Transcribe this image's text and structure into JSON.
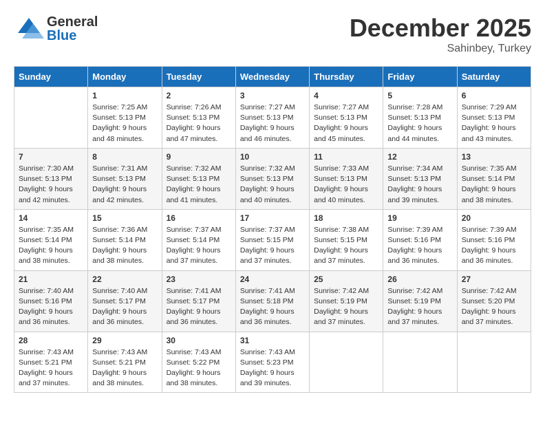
{
  "header": {
    "logo_general": "General",
    "logo_blue": "Blue",
    "month": "December 2025",
    "location": "Sahinbey, Turkey"
  },
  "days_of_week": [
    "Sunday",
    "Monday",
    "Tuesday",
    "Wednesday",
    "Thursday",
    "Friday",
    "Saturday"
  ],
  "weeks": [
    [
      {
        "day": "",
        "info": ""
      },
      {
        "day": "1",
        "info": "Sunrise: 7:25 AM\nSunset: 5:13 PM\nDaylight: 9 hours\nand 48 minutes."
      },
      {
        "day": "2",
        "info": "Sunrise: 7:26 AM\nSunset: 5:13 PM\nDaylight: 9 hours\nand 47 minutes."
      },
      {
        "day": "3",
        "info": "Sunrise: 7:27 AM\nSunset: 5:13 PM\nDaylight: 9 hours\nand 46 minutes."
      },
      {
        "day": "4",
        "info": "Sunrise: 7:27 AM\nSunset: 5:13 PM\nDaylight: 9 hours\nand 45 minutes."
      },
      {
        "day": "5",
        "info": "Sunrise: 7:28 AM\nSunset: 5:13 PM\nDaylight: 9 hours\nand 44 minutes."
      },
      {
        "day": "6",
        "info": "Sunrise: 7:29 AM\nSunset: 5:13 PM\nDaylight: 9 hours\nand 43 minutes."
      }
    ],
    [
      {
        "day": "7",
        "info": "Sunrise: 7:30 AM\nSunset: 5:13 PM\nDaylight: 9 hours\nand 42 minutes."
      },
      {
        "day": "8",
        "info": "Sunrise: 7:31 AM\nSunset: 5:13 PM\nDaylight: 9 hours\nand 42 minutes."
      },
      {
        "day": "9",
        "info": "Sunrise: 7:32 AM\nSunset: 5:13 PM\nDaylight: 9 hours\nand 41 minutes."
      },
      {
        "day": "10",
        "info": "Sunrise: 7:32 AM\nSunset: 5:13 PM\nDaylight: 9 hours\nand 40 minutes."
      },
      {
        "day": "11",
        "info": "Sunrise: 7:33 AM\nSunset: 5:13 PM\nDaylight: 9 hours\nand 40 minutes."
      },
      {
        "day": "12",
        "info": "Sunrise: 7:34 AM\nSunset: 5:13 PM\nDaylight: 9 hours\nand 39 minutes."
      },
      {
        "day": "13",
        "info": "Sunrise: 7:35 AM\nSunset: 5:14 PM\nDaylight: 9 hours\nand 38 minutes."
      }
    ],
    [
      {
        "day": "14",
        "info": "Sunrise: 7:35 AM\nSunset: 5:14 PM\nDaylight: 9 hours\nand 38 minutes."
      },
      {
        "day": "15",
        "info": "Sunrise: 7:36 AM\nSunset: 5:14 PM\nDaylight: 9 hours\nand 38 minutes."
      },
      {
        "day": "16",
        "info": "Sunrise: 7:37 AM\nSunset: 5:14 PM\nDaylight: 9 hours\nand 37 minutes."
      },
      {
        "day": "17",
        "info": "Sunrise: 7:37 AM\nSunset: 5:15 PM\nDaylight: 9 hours\nand 37 minutes."
      },
      {
        "day": "18",
        "info": "Sunrise: 7:38 AM\nSunset: 5:15 PM\nDaylight: 9 hours\nand 37 minutes."
      },
      {
        "day": "19",
        "info": "Sunrise: 7:39 AM\nSunset: 5:16 PM\nDaylight: 9 hours\nand 36 minutes."
      },
      {
        "day": "20",
        "info": "Sunrise: 7:39 AM\nSunset: 5:16 PM\nDaylight: 9 hours\nand 36 minutes."
      }
    ],
    [
      {
        "day": "21",
        "info": "Sunrise: 7:40 AM\nSunset: 5:16 PM\nDaylight: 9 hours\nand 36 minutes."
      },
      {
        "day": "22",
        "info": "Sunrise: 7:40 AM\nSunset: 5:17 PM\nDaylight: 9 hours\nand 36 minutes."
      },
      {
        "day": "23",
        "info": "Sunrise: 7:41 AM\nSunset: 5:17 PM\nDaylight: 9 hours\nand 36 minutes."
      },
      {
        "day": "24",
        "info": "Sunrise: 7:41 AM\nSunset: 5:18 PM\nDaylight: 9 hours\nand 36 minutes."
      },
      {
        "day": "25",
        "info": "Sunrise: 7:42 AM\nSunset: 5:19 PM\nDaylight: 9 hours\nand 37 minutes."
      },
      {
        "day": "26",
        "info": "Sunrise: 7:42 AM\nSunset: 5:19 PM\nDaylight: 9 hours\nand 37 minutes."
      },
      {
        "day": "27",
        "info": "Sunrise: 7:42 AM\nSunset: 5:20 PM\nDaylight: 9 hours\nand 37 minutes."
      }
    ],
    [
      {
        "day": "28",
        "info": "Sunrise: 7:43 AM\nSunset: 5:21 PM\nDaylight: 9 hours\nand 37 minutes."
      },
      {
        "day": "29",
        "info": "Sunrise: 7:43 AM\nSunset: 5:21 PM\nDaylight: 9 hours\nand 38 minutes."
      },
      {
        "day": "30",
        "info": "Sunrise: 7:43 AM\nSunset: 5:22 PM\nDaylight: 9 hours\nand 38 minutes."
      },
      {
        "day": "31",
        "info": "Sunrise: 7:43 AM\nSunset: 5:23 PM\nDaylight: 9 hours\nand 39 minutes."
      },
      {
        "day": "",
        "info": ""
      },
      {
        "day": "",
        "info": ""
      },
      {
        "day": "",
        "info": ""
      }
    ]
  ]
}
